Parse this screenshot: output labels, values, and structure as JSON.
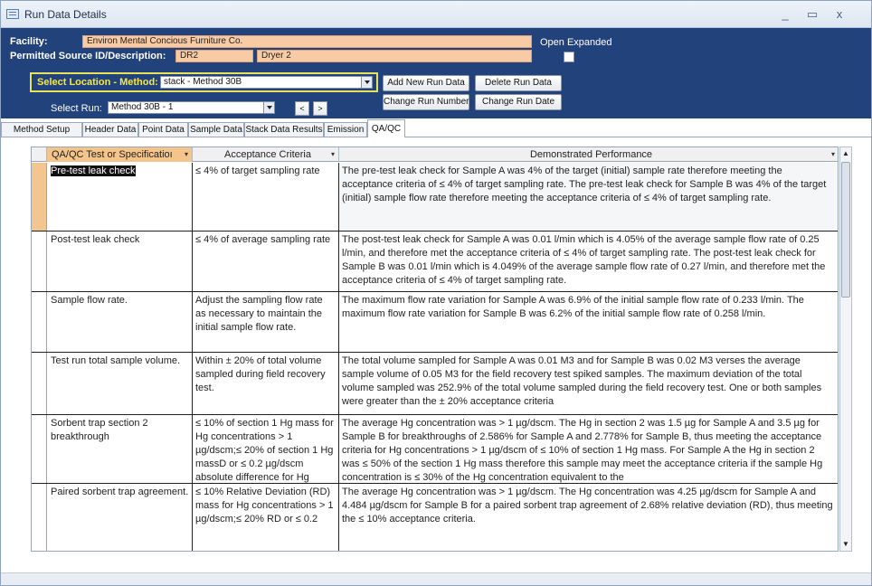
{
  "window": {
    "title": "Run Data Details",
    "controls": [
      "_",
      "▭",
      "x"
    ]
  },
  "header": {
    "facility_label": "Facility:",
    "facility_value": "Environ Mental Concious Furniture Co.",
    "source_label": "Permitted Source ID/Description:",
    "source_id": "DR2",
    "source_desc": "Dryer 2",
    "open_expanded_label": "Open Expanded",
    "open_expanded_checked": false,
    "location_label": "Select Location - Method:",
    "location_value": "stack - Method 30B",
    "run_label": "Select Run:",
    "run_value": "Method 30B - 1",
    "prev_label": "<",
    "next_label": ">",
    "buttons": {
      "add_run": "Add New Run Data",
      "delete_run": "Delete Run Data",
      "change_number": "Change Run Number",
      "change_date": "Change Run Date"
    }
  },
  "tabs": [
    "Method Setup",
    "Header Data",
    "Point Data",
    "Sample Data",
    "Stack Data Results",
    "Emission",
    "QA/QC"
  ],
  "active_tab": "QA/QC",
  "grid": {
    "columns": [
      "QA/QC Test or Specificatioı",
      "Acceptance Criteria",
      "Demonstrated Performance"
    ],
    "rows": [
      {
        "test": "Pre-test leak check",
        "criteria": "≤ 4% of target sampling rate",
        "performance": "The pre-test leak check for Sample A was 4% of the target (initial) sample rate therefore meeting the acceptance criteria of ≤ 4% of target sampling rate. The pre-test leak check for Sample B was 4% of the target (initial) sample flow rate therefore meeting the acceptance criteria of ≤ 4% of target sampling rate."
      },
      {
        "test": "Post-test leak check",
        "criteria": "≤ 4% of average sampling rate",
        "performance": "The post-test leak check for Sample A was 0.01 l/min which is 4.05% of the average sample flow rate of 0.25 l/min, and therefore met the acceptance criteria of ≤ 4% of target sampling rate. The post-test leak check for Sample B was 0.01 l/min which is 4.049% of the average sample flow rate of 0.27 l/min, and therefore met the acceptance criteria of ≤ 4% of target sampling rate."
      },
      {
        "test": "Sample flow rate.",
        "criteria": "Adjust the sampling flow rate as necessary to maintain the initial sample flow rate.",
        "performance": "The maximum flow rate variation for Sample A was 6.9% of the initial sample flow rate of 0.233 l/min. The maximum flow rate variation for Sample B was 6.2% of the initial sample flow rate of 0.258 l/min."
      },
      {
        "test": "Test run total sample volume.",
        "criteria": "Within ± 20% of total volume sampled during field recovery test.",
        "performance": "The total volume sampled for Sample A was 0.01 M3 and for Sample B was 0.02 M3 verses the average sample volume of 0.05 M3 for the field recovery test spiked samples. The maximum deviation of the total volume sampled was 252.9% of the total volume sampled during the field recovery test. One or both samples were greater than the ± 20% acceptance criteria"
      },
      {
        "test": "Sorbent trap section 2 breakthrough",
        "criteria": "≤ 10% of section 1 Hg mass for Hg concentrations > 1 µg/dscm;≤ 20% of section 1 Hg massD or ≤ 0.2 µg/dscm absolute difference for Hg",
        "performance": "The average Hg concentration was > 1 µg/dscm. The Hg in section 2 was 1.5 µg for Sample A and 3.5 µg for Sample B for breakthroughs of 2.586% for Sample A and 2.778% for Sample B, thus meeting the acceptance criteria for Hg concentrations > 1 µg/dscm of ≤ 10% of section 1 Hg mass. For Sample A the Hg in section 2 was ≤ 50% of the section 1 Hg mass therefore this sample may meet the acceptance criteria if the sample Hg concentration is ≤ 30% of the Hg concentration equivalent to the"
      },
      {
        "test": "Paired sorbent trap agreement.",
        "criteria": "≤ 10% Relative Deviation (RD) mass for Hg concentrations > 1 µg/dscm;≤ 20% RD or ≤ 0.2",
        "performance": "The average Hg concentration was > 1 µg/dscm. The Hg concentration was 4.25 µg/dscm for Sample A and 4.484 µg/dscm for Sample B for a paired sorbent trap agreement of 2.68% relative deviation (RD), thus meeting the ≤ 10% acceptance criteria."
      }
    ]
  }
}
